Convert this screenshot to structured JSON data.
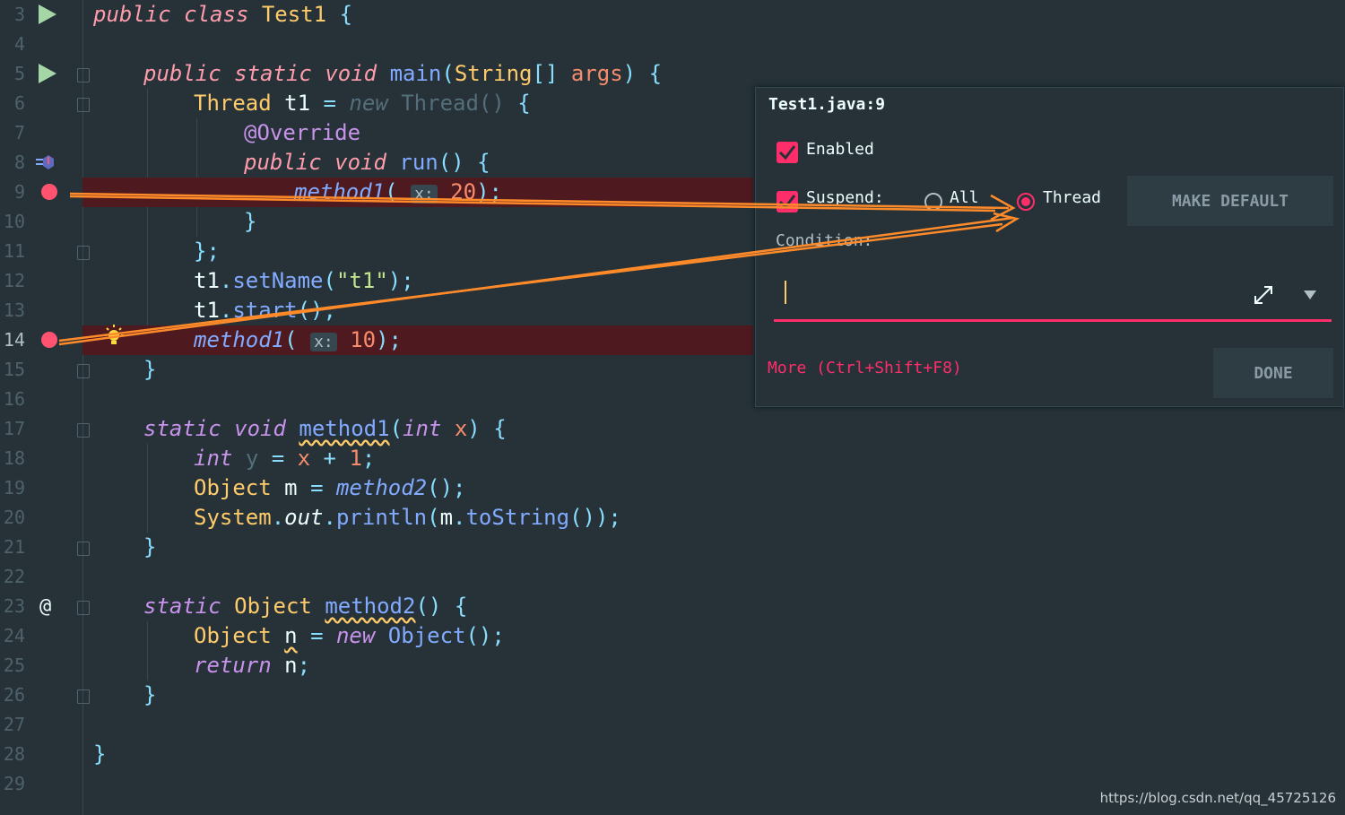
{
  "editor": {
    "line_numbers": [
      "3",
      "4",
      "5",
      "6",
      "7",
      "8",
      "9",
      "10",
      "11",
      "12",
      "13",
      "14",
      "15",
      "16",
      "17",
      "18",
      "19",
      "20",
      "21",
      "22",
      "23",
      "24",
      "25",
      "26",
      "27",
      "28",
      "29"
    ],
    "code": {
      "l3": {
        "kw1": "public",
        "kw2": "class",
        "name": "Test1",
        "brace": "{"
      },
      "l5": {
        "kw1": "public",
        "kw2": "static",
        "kw3": "void",
        "fn": "main",
        "p1": "(",
        "ty": "String",
        "arr": "[]",
        "arg": "args",
        "p2": ")",
        "brace": "{"
      },
      "l6": {
        "ty": "Thread",
        "var": "t1",
        "eq": "=",
        "new": "new",
        "ctor": "Thread()",
        "brace": "{"
      },
      "l7": {
        "ann": "@Override"
      },
      "l8": {
        "kw1": "public",
        "kw2": "void",
        "fn": "run",
        "p": "()",
        "brace": "{"
      },
      "l9": {
        "fn": "method1",
        "p1": "(",
        "hint": "x:",
        "num": "20",
        "p2": ");"
      },
      "l10": {
        "brace": "}"
      },
      "l11": {
        "text": "};"
      },
      "l12": {
        "var": "t1",
        "dot": ".",
        "fn": "setName",
        "p1": "(",
        "str": "\"t1\"",
        "p2": ");"
      },
      "l13": {
        "var": "t1",
        "dot": ".",
        "fn": "start",
        "p": "();"
      },
      "l14": {
        "fn": "method1",
        "p1": "(",
        "hint": "x:",
        "num": "10",
        "p2": ");"
      },
      "l15": {
        "brace": "}"
      },
      "l17": {
        "kw1": "static",
        "kw2": "void",
        "fn": "method1",
        "p1": "(",
        "ty": "int",
        "par": "x",
        "p2": ")",
        "brace": "{"
      },
      "l18": {
        "ty": "int",
        "var": "y",
        "eq": "=",
        "par": "x",
        "plus": "+",
        "num": "1",
        "semi": ";"
      },
      "l19": {
        "ty": "Object",
        "var": "m",
        "eq": "=",
        "fn": "method2",
        "p": "();"
      },
      "l20": {
        "cls": "System",
        "dot": ".",
        "fld": "out",
        "dot2": ".",
        "fn": "println",
        "p1": "(",
        "var": "m",
        "dot3": ".",
        "fn2": "toString",
        "p2": "());"
      },
      "l21": {
        "brace": "}"
      },
      "l23": {
        "kw1": "static",
        "ty": "Object",
        "fn": "method2",
        "p": "()",
        "brace": "{"
      },
      "l24": {
        "ty": "Object",
        "var": "n",
        "eq": "=",
        "new": "new",
        "ctor": "Object",
        "p": "();"
      },
      "l25": {
        "kw": "return",
        "var": "n",
        "semi": ";"
      },
      "l26": {
        "brace": "}"
      },
      "l28": {
        "brace": "}"
      }
    },
    "gutter_icons": [
      "run-icon",
      "breakpoint-icon",
      "implements-icon",
      "override-at-icon",
      "lightbulb-icon",
      "fold-icon"
    ]
  },
  "dialog": {
    "title": "Test1.java:9",
    "enabled_label": "Enabled",
    "enabled_checked": true,
    "suspend_label": "Suspend:",
    "suspend_checked": true,
    "radio_all": "All",
    "radio_thread": "Thread",
    "selected_radio": "Thread",
    "make_default": "MAKE DEFAULT",
    "condition_label": "Condition:",
    "condition_value": "",
    "more_link": "More (Ctrl+Shift+F8)",
    "done": "DONE"
  },
  "colors": {
    "background": "#263238",
    "breakpoint": "#ff5370",
    "accent": "#ff2d6a",
    "arrow": "#ff8a2a"
  },
  "watermark": "https://blog.csdn.net/qq_45725126"
}
